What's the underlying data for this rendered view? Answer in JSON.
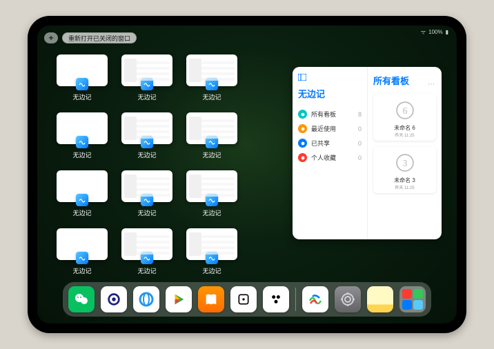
{
  "status": {
    "battery": "100%",
    "signal": "●●●"
  },
  "header": {
    "plus_label": "+",
    "reopen_label": "重新打开已关闭的窗口"
  },
  "app_name": "无边记",
  "thumbnails": [
    {
      "label": "无边记",
      "simple": true
    },
    {
      "label": "无边记",
      "simple": false
    },
    {
      "label": "无边记",
      "simple": false
    },
    {
      "label": "无边记",
      "simple": true
    },
    {
      "label": "无边记",
      "simple": false
    },
    {
      "label": "无边记",
      "simple": false
    },
    {
      "label": "无边记",
      "simple": true
    },
    {
      "label": "无边记",
      "simple": false
    },
    {
      "label": "无边记",
      "simple": false
    },
    {
      "label": "无边记",
      "simple": true
    },
    {
      "label": "无边记",
      "simple": false
    },
    {
      "label": "无边记",
      "simple": false
    }
  ],
  "panel": {
    "left_title": "无边记",
    "right_title": "所有看板",
    "top_icon": "▢",
    "items": [
      {
        "icon": "cyan",
        "label": "所有看板",
        "count": 8
      },
      {
        "icon": "orange",
        "label": "最近使用",
        "count": 0
      },
      {
        "icon": "blue",
        "label": "已共享",
        "count": 0
      },
      {
        "icon": "red",
        "label": "个人收藏",
        "count": 0
      }
    ],
    "boards": [
      {
        "name": "未命名 6",
        "date": "昨天 11:25",
        "sketch": "6"
      },
      {
        "name": "未命名 3",
        "date": "昨天 11:25",
        "sketch": "3"
      }
    ]
  },
  "dock": {
    "apps": [
      {
        "name": "wechat"
      },
      {
        "name": "quark"
      },
      {
        "name": "qqbrowser"
      },
      {
        "name": "play"
      },
      {
        "name": "books"
      },
      {
        "name": "unknown-white"
      },
      {
        "name": "unknown-dots"
      },
      {
        "name": "freeform"
      },
      {
        "name": "settings"
      },
      {
        "name": "notes"
      }
    ]
  }
}
